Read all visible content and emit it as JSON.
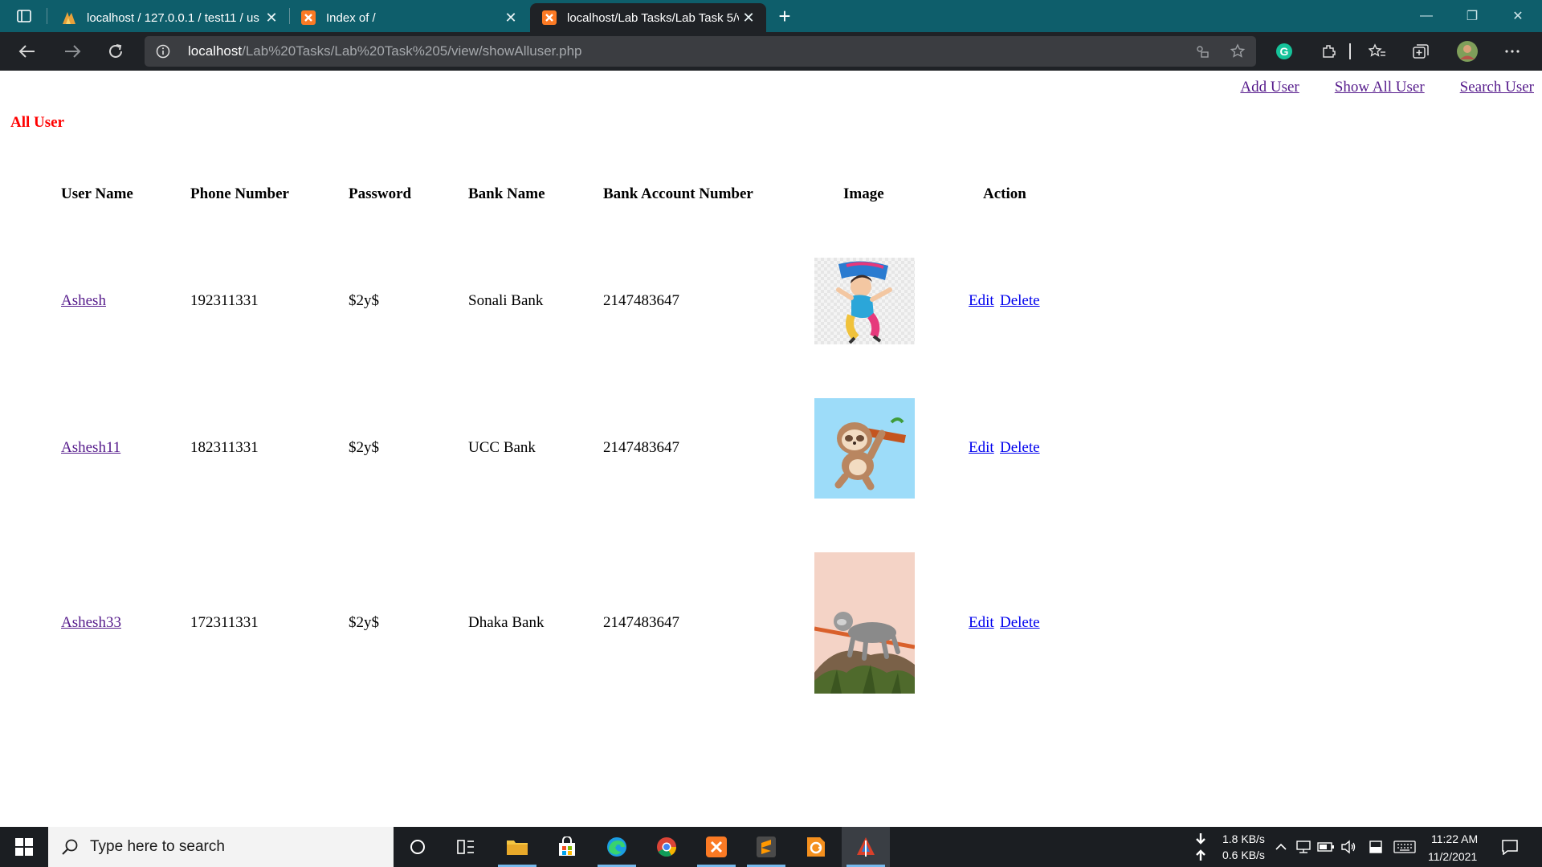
{
  "browser": {
    "tabs": [
      {
        "title": "localhost / 127.0.0.1 / test11 / us",
        "close": "✕"
      },
      {
        "title": "Index of /",
        "close": "✕"
      },
      {
        "title": "localhost/Lab Tasks/Lab Task 5/v",
        "close": "✕"
      }
    ],
    "new_tab": "+",
    "address": {
      "host": "localhost",
      "path": "/Lab%20Tasks/Lab%20Task%205/view/showAlluser.php"
    },
    "window_controls": {
      "minimize": "—",
      "restore": "❐",
      "close": "✕"
    },
    "accent_color": "#0e5e6b"
  },
  "page": {
    "nav": {
      "add_user": "Add User",
      "show_all_user": "Show All User",
      "search_user": "Search User"
    },
    "heading": "All User",
    "heading_color": "#ff0000",
    "table": {
      "headers": {
        "user_name": "User Name",
        "phone": "Phone Number",
        "password": "Password",
        "bank": "Bank Name",
        "account": "Bank Account Number",
        "image": "Image",
        "action": "Action"
      },
      "rows": [
        {
          "user_name": "Ashesh",
          "phone": "192311331",
          "password": "$2y$",
          "bank": "Sonali Bank",
          "account": "2147483647",
          "image": "cartoon-person-jumping-image",
          "edit": "Edit",
          "delete": "Delete"
        },
        {
          "user_name": "Ashesh11",
          "phone": "182311331",
          "password": "$2y$",
          "bank": "UCC Bank",
          "account": "2147483647",
          "image": "cartoon-sloth-hanging-image",
          "edit": "Edit",
          "delete": "Delete"
        },
        {
          "user_name": "Ashesh33",
          "phone": "172311331",
          "password": "$2y$",
          "bank": "Dhaka Bank",
          "account": "2147483647",
          "image": "sloth-on-branch-illustration",
          "edit": "Edit",
          "delete": "Delete"
        }
      ]
    }
  },
  "taskbar": {
    "search_placeholder": "Type here to search",
    "net_down": "1.8 KB/s",
    "net_up": "0.6 KB/s",
    "time": "11:22 AM",
    "date": "11/2/2021"
  }
}
